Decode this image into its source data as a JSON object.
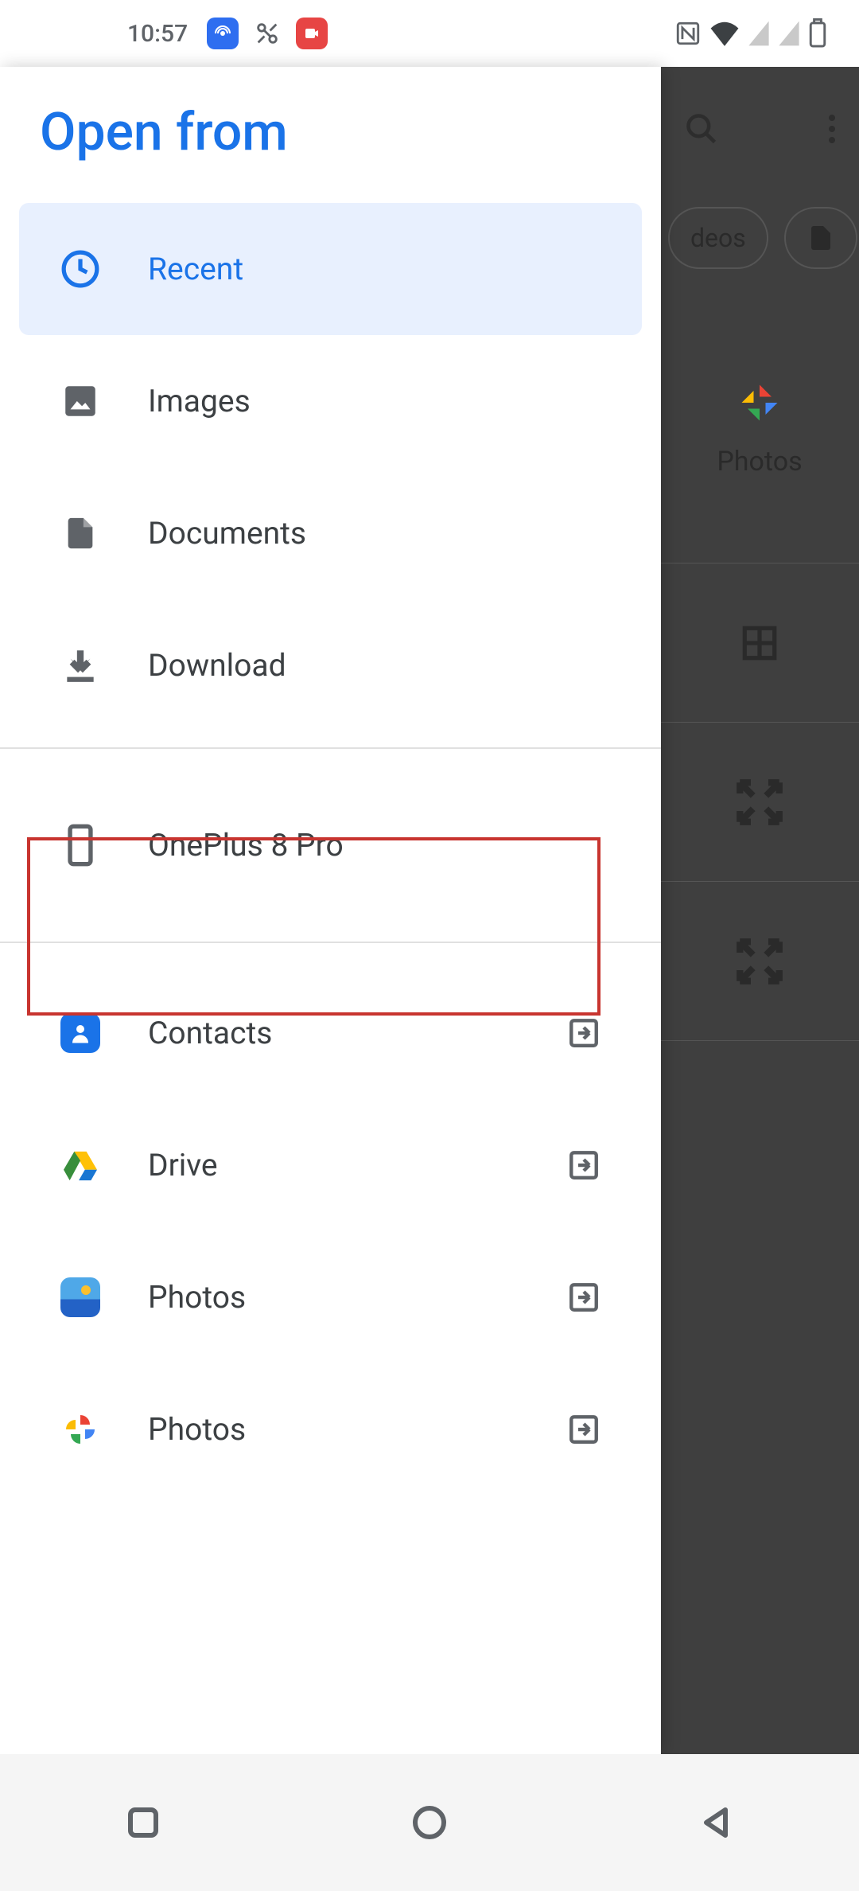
{
  "status_bar": {
    "time": "10:57"
  },
  "background": {
    "chip_videos": "deos",
    "photos_label": "Photos"
  },
  "drawer": {
    "title": "Open from",
    "items": {
      "recent": "Recent",
      "images": "Images",
      "documents": "Documents",
      "download": "Download",
      "device": "OnePlus 8 Pro",
      "contacts": "Contacts",
      "drive": "Drive",
      "photos_local": "Photos",
      "photos_google": "Photos"
    }
  }
}
